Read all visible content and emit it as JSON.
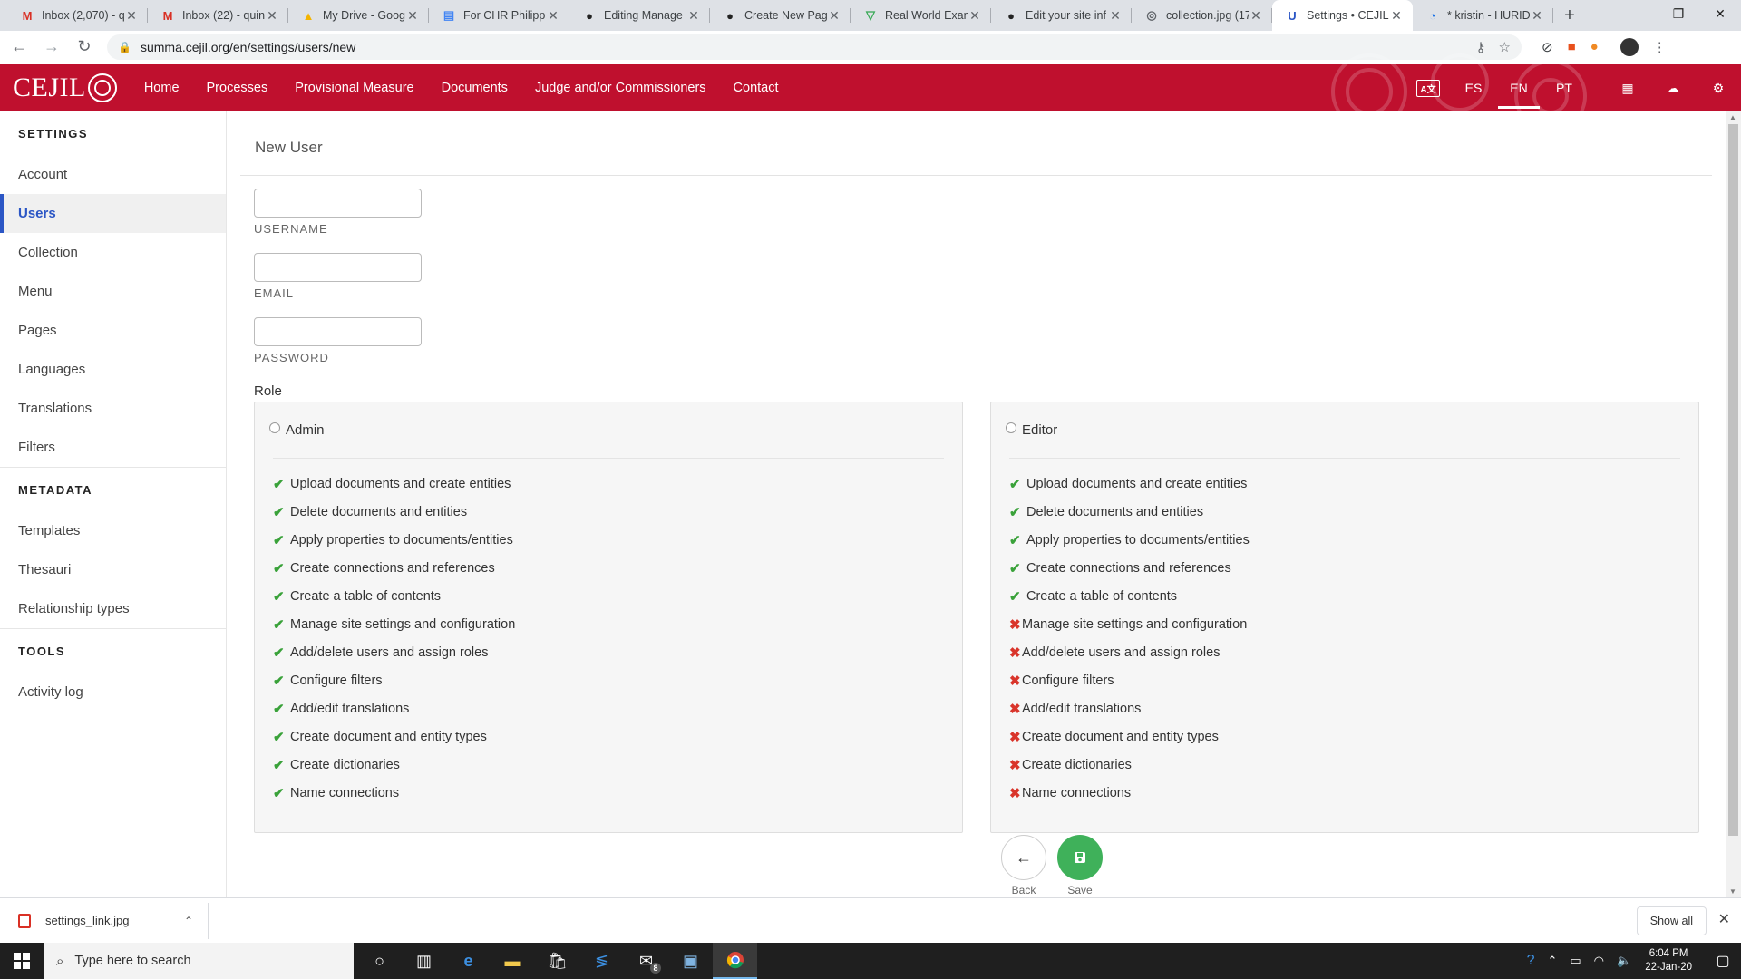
{
  "browser": {
    "tabs": [
      {
        "title": "Inbox (2,070) - q",
        "fav": "M",
        "fav_color": "#d93025",
        "active": false
      },
      {
        "title": "Inbox (22) - quin",
        "fav": "M",
        "fav_color": "#d93025",
        "active": false
      },
      {
        "title": "My Drive - Googl",
        "fav": "▲",
        "fav_color": "#f4b400",
        "active": false
      },
      {
        "title": "For CHR Philippin",
        "fav": "▤",
        "fav_color": "#4285f4",
        "active": false
      },
      {
        "title": "Editing Manage",
        "fav": "●",
        "fav_color": "#222222",
        "active": false
      },
      {
        "title": "Create New Page",
        "fav": "●",
        "fav_color": "#222222",
        "active": false
      },
      {
        "title": "Real World Exam",
        "fav": "▽",
        "fav_color": "#34a853",
        "active": false
      },
      {
        "title": "Edit your site inf",
        "fav": "●",
        "fav_color": "#222222",
        "active": false
      },
      {
        "title": "collection.jpg (17",
        "fav": "◎",
        "fav_color": "#5f6368",
        "active": false
      },
      {
        "title": "Settings • CEJIL",
        "fav": "U",
        "fav_color": "#2b56c5",
        "active": true
      },
      {
        "title": "* kristin - HURID",
        "fav": "◔",
        "fav_color": "#1a73e8",
        "active": false
      }
    ],
    "url": "summa.cejil.org/en/settings/users/new"
  },
  "app": {
    "logo_text": "CEJIL",
    "nav": [
      "Home",
      "Processes",
      "Provisional Measure",
      "Documents",
      "Judge and/or Commissioners",
      "Contact"
    ],
    "languages": [
      "ES",
      "EN",
      "PT"
    ],
    "active_language": "EN",
    "brand_color": "#bf102e"
  },
  "sidebar": {
    "sections": [
      {
        "heading": "SETTINGS",
        "items": [
          "Account",
          "Users",
          "Collection",
          "Menu",
          "Pages",
          "Languages",
          "Translations",
          "Filters"
        ]
      },
      {
        "heading": "METADATA",
        "items": [
          "Templates",
          "Thesauri",
          "Relationship types"
        ]
      },
      {
        "heading": "TOOLS",
        "items": [
          "Activity log"
        ]
      }
    ],
    "active_item": "Users"
  },
  "form": {
    "title": "New User",
    "fields": {
      "username": {
        "label": "USERNAME",
        "value": ""
      },
      "email": {
        "label": "EMAIL",
        "value": ""
      },
      "password": {
        "label": "PASSWORD",
        "value": ""
      }
    },
    "role_label": "Role",
    "roles": [
      {
        "name": "Admin",
        "selected": false,
        "permissions": [
          {
            "text": "Upload documents and create entities",
            "allowed": true
          },
          {
            "text": "Delete documents and entities",
            "allowed": true
          },
          {
            "text": "Apply properties to documents/entities",
            "allowed": true
          },
          {
            "text": "Create connections and references",
            "allowed": true
          },
          {
            "text": "Create a table of contents",
            "allowed": true
          },
          {
            "text": "Manage site settings and configuration",
            "allowed": true
          },
          {
            "text": "Add/delete users and assign roles",
            "allowed": true
          },
          {
            "text": "Configure filters",
            "allowed": true
          },
          {
            "text": "Add/edit translations",
            "allowed": true
          },
          {
            "text": "Create document and entity types",
            "allowed": true
          },
          {
            "text": "Create dictionaries",
            "allowed": true
          },
          {
            "text": "Name connections",
            "allowed": true
          }
        ]
      },
      {
        "name": "Editor",
        "selected": false,
        "permissions": [
          {
            "text": "Upload documents and create entities",
            "allowed": true
          },
          {
            "text": "Delete documents and entities",
            "allowed": true
          },
          {
            "text": "Apply properties to documents/entities",
            "allowed": true
          },
          {
            "text": "Create connections and references",
            "allowed": true
          },
          {
            "text": "Create a table of contents",
            "allowed": true
          },
          {
            "text": "Manage site settings and configuration",
            "allowed": false
          },
          {
            "text": "Add/delete users and assign roles",
            "allowed": false
          },
          {
            "text": "Configure filters",
            "allowed": false
          },
          {
            "text": "Add/edit translations",
            "allowed": false
          },
          {
            "text": "Create document and entity types",
            "allowed": false
          },
          {
            "text": "Create dictionaries",
            "allowed": false
          },
          {
            "text": "Name connections",
            "allowed": false
          }
        ]
      }
    ],
    "back_label": "Back",
    "save_label": "Save"
  },
  "downloads": {
    "file": "settings_link.jpg",
    "show_all": "Show all"
  },
  "taskbar": {
    "search_placeholder": "Type here to search",
    "mail_badge": "8",
    "time": "6:04 PM",
    "date": "22-Jan-20"
  }
}
